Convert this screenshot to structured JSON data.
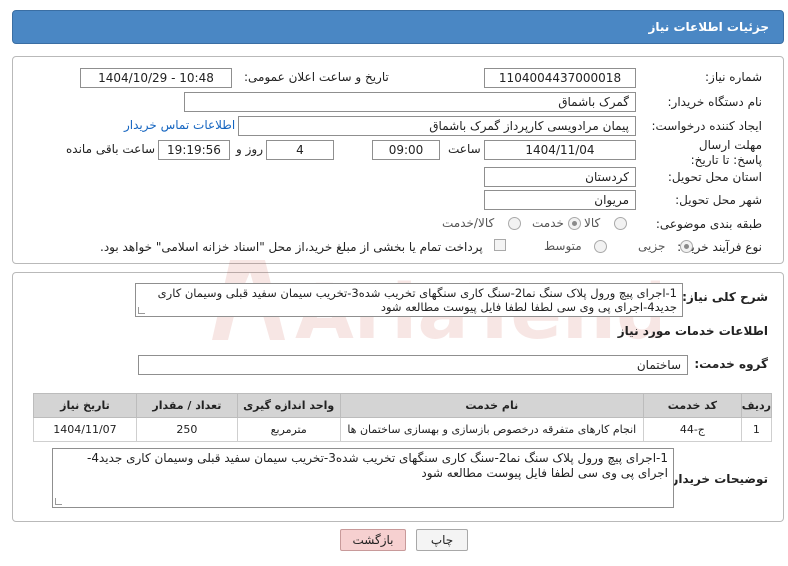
{
  "header": {
    "title": "جزئیات اطلاعات نیاز"
  },
  "form": {
    "need_number_label": "شماره نیاز:",
    "need_number": "1104004437000018",
    "announce_label": "تاریخ و ساعت اعلان عمومی:",
    "announce_value": "1404/10/29 - 10:48",
    "buyer_org_label": "نام دستگاه خریدار:",
    "buyer_org": "گمرک باشماق",
    "creator_label": "ایجاد کننده درخواست:",
    "creator": "پیمان مرادویسی کارپرداز گمرک باشماق",
    "contact_link": "اطلاعات تماس خریدار",
    "deadline_label": "مهلت ارسال پاسخ: تا تاریخ:",
    "deadline_date": "1404/11/04",
    "time_label": "ساعت",
    "deadline_time": "09:00",
    "days_value": "4",
    "days_label": "روز و",
    "remaining_time": "19:19:56",
    "remaining_label": "ساعت باقی مانده",
    "province_label": "استان محل تحویل:",
    "province": "کردستان",
    "city_label": "شهر محل تحویل:",
    "city": "مریوان",
    "category_label": "طبقه بندی موضوعی:",
    "category_options": [
      "کالا",
      "خدمت",
      "کالا/خدمت"
    ],
    "category_selected": "خدمت",
    "process_label": "نوع فرآیند خرید :",
    "process_options": [
      "جزیی",
      "متوسط"
    ],
    "process_selected": "جزیی",
    "treasury_note": "پرداخت تمام یا بخشی از مبلغ خرید،از محل \"اسناد خزانه اسلامی\" خواهد بود."
  },
  "details": {
    "summary_label": "شرح کلی نیاز:",
    "summary_text": "1-اجرای پیچ ورول پلاک سنگ نما2-سنگ کاری سنگهای تخریب شده3-تخریب سیمان سفید قبلی وسیمان کاری جدید4-اجرای پی وی سی لطفا لطفا فایل پیوست مطالعه شود",
    "services_title": "اطلاعات خدمات مورد نیاز",
    "group_label": "گروه خدمت:",
    "group_value": "ساختمان",
    "table": {
      "headers": [
        "ردیف",
        "کد خدمت",
        "نام خدمت",
        "واحد اندازه گیری",
        "تعداد / مقدار",
        "تاریخ نیاز"
      ],
      "rows": [
        [
          "1",
          "ج-44",
          "انجام کارهای متفرقه درخصوص بازسازی و بهسازی ساختمان ها",
          "مترمربع",
          "250",
          "1404/11/07"
        ]
      ]
    },
    "buyer_notes_label": "توضیحات خریدار:",
    "buyer_notes": "1-اجرای پیچ ورول پلاک سنگ نما2-سنگ کاری سنگهای تخریب شده3-تخریب سیمان سفید قبلی وسیمان کاری جدید4-اجرای پی وی سی لطفا فایل پیوست مطالعه شود"
  },
  "buttons": {
    "print": "چاپ",
    "back": "بازگشت"
  },
  "watermark_text": "AriaTender.neT",
  "colors": {
    "header": "#4a87c4",
    "link": "#1565c0",
    "back_button": "#f6d0d0",
    "table_header": "#d4d4d4"
  }
}
